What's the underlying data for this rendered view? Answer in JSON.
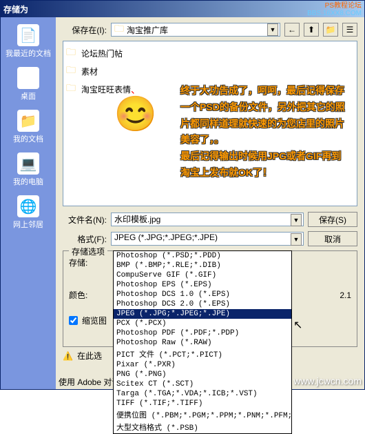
{
  "title": "存储为",
  "watermark": {
    "line1": "PS教程论坛",
    "line2": "BBS.16XX8.COM"
  },
  "save_in_label": "保存在(I):",
  "save_in_value": "淘宝推广库",
  "sidebar": [
    {
      "label": "我最近的文档",
      "icon": "📄"
    },
    {
      "label": "桌面",
      "icon": "🖥"
    },
    {
      "label": "我的文档",
      "icon": "📁"
    },
    {
      "label": "我的电脑",
      "icon": "💻"
    },
    {
      "label": "网上邻居",
      "icon": "🌐"
    }
  ],
  "files": [
    {
      "name": "论坛热门帖"
    },
    {
      "name": "素材"
    },
    {
      "name": "淘宝旺旺表情"
    }
  ],
  "tip": "终于大功告成了，呵呵，最后记得保存一个PSD的备份文件，另外把其它的照片都同样道理就快速的为您店里的照片美容了，。\n最后记得输出时候用JPG或者GIF再到淘宝上发布就OK了！",
  "filename_label": "文件名(N):",
  "filename_value": "水印模板.jpg",
  "format_label": "格式(F):",
  "format_value": "JPEG (*.JPG;*.JPEG;*.JPE)",
  "save_btn": "保存(S)",
  "cancel_btn": "取消",
  "options_label": "存储选项",
  "store_label": "存储:",
  "color_label": "颜色:",
  "version_text": "2.1",
  "thumb_label": "缩览图",
  "warn_text": "在此选",
  "footer": "使用 Adobe 对话框",
  "bottom_wm": "www.jcwcn.com",
  "formats": [
    "Photoshop (*.PSD;*.PDD)",
    "BMP (*.BMP;*.RLE;*.DIB)",
    "CompuServe GIF (*.GIF)",
    "Photoshop EPS (*.EPS)",
    "Photoshop DCS 1.0 (*.EPS)",
    "Photoshop DCS 2.0 (*.EPS)",
    "JPEG (*.JPG;*.JPEG;*.JPE)",
    "PCX (*.PCX)",
    "Photoshop PDF (*.PDF;*.PDP)",
    "Photoshop Raw (*.RAW)",
    "PICT 文件 (*.PCT;*.PICT)",
    "Pixar (*.PXR)",
    "PNG (*.PNG)",
    "Scitex CT (*.SCT)",
    "Targa (*.TGA;*.VDA;*.ICB;*.VST)",
    "TIFF (*.TIF;*.TIFF)",
    "便携位图 (*.PBM;*.PGM;*.PPM;*.PNM;*.PFM;*.",
    "大型文档格式 (*.PSB)"
  ],
  "selected_format_index": 6
}
